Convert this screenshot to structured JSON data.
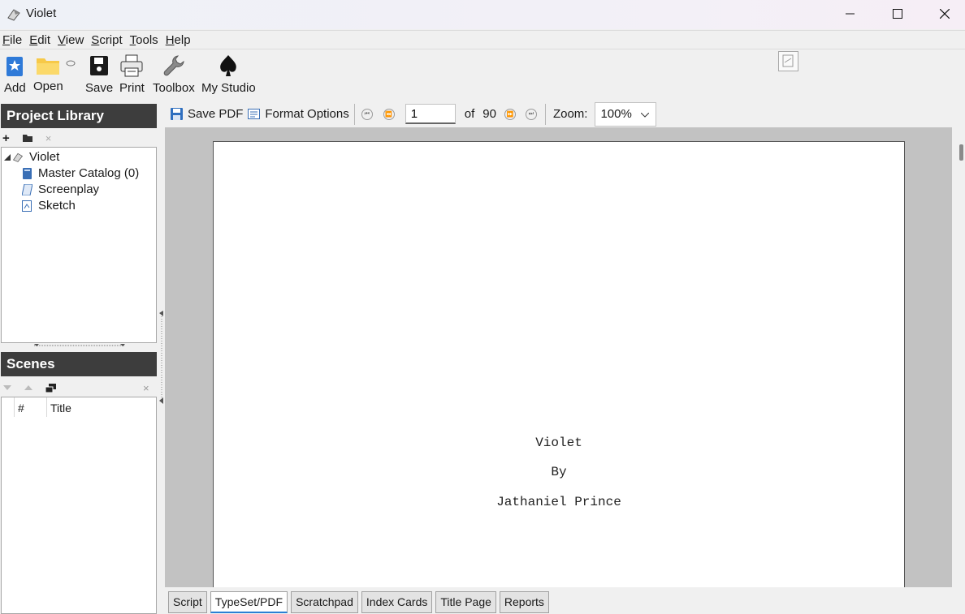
{
  "window": {
    "title": "Violet"
  },
  "menu": [
    "File",
    "Edit",
    "View",
    "Script",
    "Tools",
    "Help"
  ],
  "toolbar": {
    "add": "Add",
    "open": "Open",
    "save": "Save",
    "print": "Print",
    "toolbox": "Toolbox",
    "studio": "My Studio"
  },
  "library": {
    "title": "Project Library",
    "tree": {
      "root": "Violet",
      "items": [
        "Master Catalog (0)",
        "Screenplay",
        "Sketch"
      ]
    }
  },
  "scenes": {
    "title": "Scenes",
    "columns": [
      "#",
      "Title"
    ]
  },
  "doc_toolbar": {
    "save_pdf": "Save PDF",
    "format_options": "Format Options",
    "page": "1",
    "of": "of",
    "total_pages": "90",
    "zoom_label": "Zoom:",
    "zoom_value": "100%"
  },
  "page": {
    "title": "Violet",
    "by": "By",
    "author": "Jathaniel Prince"
  },
  "tabs": [
    "Script",
    "TypeSet/PDF",
    "Scratchpad",
    "Index Cards",
    "Title Page",
    "Reports"
  ],
  "active_tab": "TypeSet/PDF",
  "colors": {
    "panel_header": "#3d3d3d",
    "active_tab_accent": "#2b7fd4",
    "viewer_bg": "#c2c2c2"
  }
}
